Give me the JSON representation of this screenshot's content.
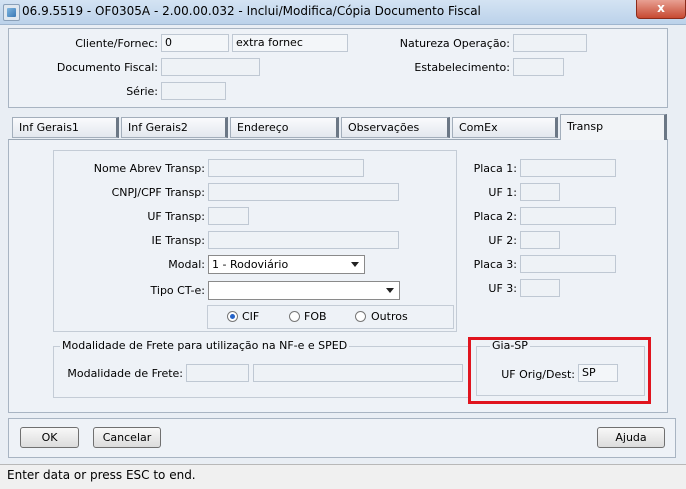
{
  "window": {
    "title": "06.9.5519 - OF0305A - 2.00.00.032 - Inclui/Modifica/Cópia Documento Fiscal",
    "close_glyph": "x"
  },
  "header": {
    "cliente_fornec": {
      "label": "Cliente/Fornec:",
      "code": "0",
      "name": "extra fornec"
    },
    "documento_fiscal": {
      "label": "Documento Fiscal:",
      "value": ""
    },
    "serie": {
      "label": "Série:",
      "value": ""
    },
    "natureza_operacao": {
      "label": "Natureza Operação:",
      "value": ""
    },
    "estabelecimento": {
      "label": "Estabelecimento:",
      "value": ""
    }
  },
  "tabs": [
    {
      "label": "Inf Gerais1",
      "active": false
    },
    {
      "label": "Inf Gerais2",
      "active": false
    },
    {
      "label": "Endereço",
      "active": false
    },
    {
      "label": "Observações",
      "active": false
    },
    {
      "label": "ComEx",
      "active": false
    },
    {
      "label": "Transp",
      "active": true
    }
  ],
  "transp": {
    "nome_abrev": {
      "label": "Nome Abrev Transp:",
      "value": ""
    },
    "cnpj_cpf": {
      "label": "CNPJ/CPF Transp:",
      "value": ""
    },
    "uf": {
      "label": "UF Transp:",
      "value": ""
    },
    "ie": {
      "label": "IE Transp:",
      "value": ""
    },
    "modal": {
      "label": "Modal:",
      "value": "1 - Rodoviário"
    },
    "tipo_cte": {
      "label": "Tipo CT-e:",
      "value": ""
    },
    "frete_options": [
      {
        "label": "CIF",
        "selected": true
      },
      {
        "label": "FOB",
        "selected": false
      },
      {
        "label": "Outros",
        "selected": false
      }
    ],
    "placa1": {
      "label": "Placa 1:",
      "value": ""
    },
    "uf1": {
      "label": "UF 1:",
      "value": ""
    },
    "placa2": {
      "label": "Placa 2:",
      "value": ""
    },
    "uf2": {
      "label": "UF 2:",
      "value": ""
    },
    "placa3": {
      "label": "Placa 3:",
      "value": ""
    },
    "uf3": {
      "label": "UF 3:",
      "value": ""
    }
  },
  "modalidade_frete": {
    "group_title": "Modalidade de Frete para utilização na NF-e e SPED",
    "label": "Modalidade de Frete:",
    "code": "",
    "description": ""
  },
  "gia_sp": {
    "group_title": "Gia-SP",
    "uf_label": "UF Orig/Dest:",
    "uf_value": "SP",
    "highlight_color": "#e0141e"
  },
  "buttons": {
    "ok": "OK",
    "cancelar": "Cancelar",
    "ajuda": "Ajuda"
  },
  "status": {
    "text": "Enter data or press ESC to end."
  }
}
